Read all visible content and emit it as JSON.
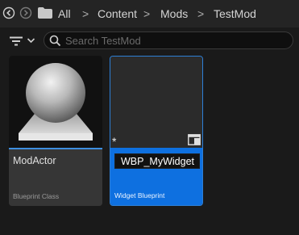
{
  "pathbar": {
    "crumbs": [
      "All",
      "Content",
      "Mods",
      "TestMod"
    ],
    "separator": ">"
  },
  "toolbar": {
    "search_placeholder": "Search TestMod"
  },
  "assets": [
    {
      "name": "ModActor",
      "type": "Blueprint Class",
      "selected": false
    },
    {
      "name": "WBP_MyWidget",
      "type": "Widget Blueprint",
      "selected": true,
      "renaming": true,
      "unsaved_marker": "*"
    }
  ],
  "colors": {
    "selection": "#0e70e0",
    "accent": "#3e8fe0"
  }
}
